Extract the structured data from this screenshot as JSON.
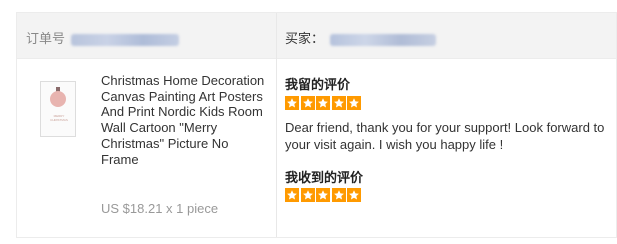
{
  "header": {
    "order_label": "订单号",
    "buyer_label": "买家："
  },
  "product": {
    "thumbnail_text": "MERRY CHRISTMAS",
    "title": "Christmas Home Decoration Canvas Painting Art Posters And Print Nordic Kids Room Wall Cartoon \"Merry Christmas\" Picture No Frame",
    "price": "US $18.21 x 1 piece"
  },
  "my_review": {
    "heading": "我留的评价",
    "rating": 5,
    "rating_max": 5,
    "comment": "Dear friend, thank you for your support! Look forward to your visit again. I wish you happy life !"
  },
  "received_review": {
    "heading": "我收到的评价",
    "rating": 5,
    "rating_max": 5
  },
  "colors": {
    "star": "#ff9a00",
    "header_bg": "#f3f3f3",
    "border": "#ececec",
    "muted_text": "#999999"
  }
}
